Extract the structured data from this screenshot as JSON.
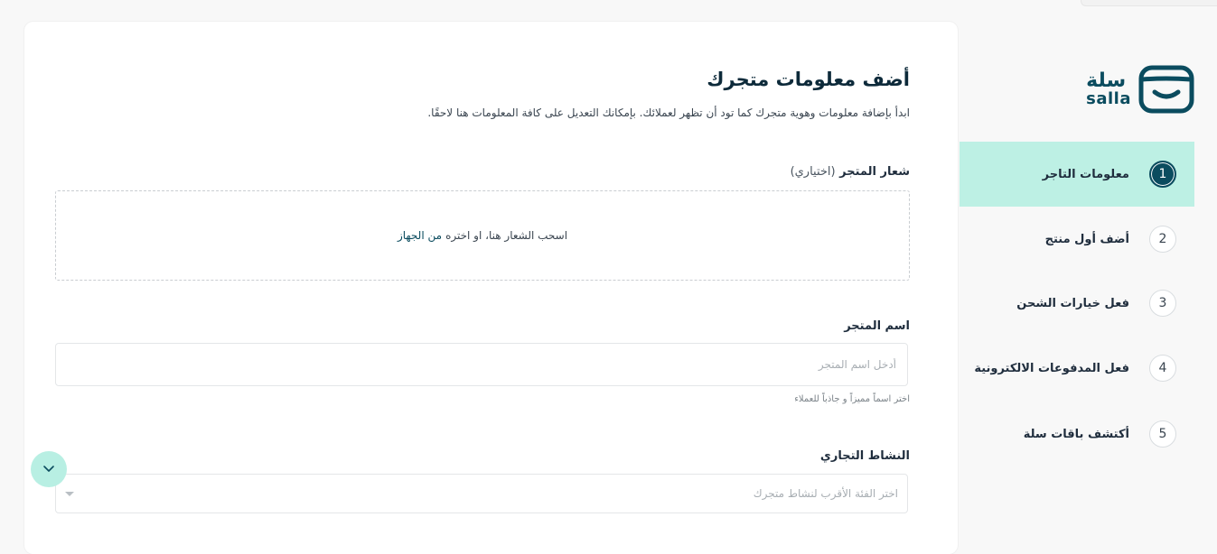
{
  "form": {
    "title": "أضف معلومات متجرك",
    "subtitle": "ابدأ بإضافة معلومات وهوية متجرك كما تود أن تظهر لعملائك. بإمكانك التعديل على كافة المعلومات هنا لاحقًا.",
    "logo_label": "شعار المتجر",
    "logo_optional": "(اختياري)",
    "dropzone_text": "اسحب الشعار هنا، او اختره",
    "dropzone_link": "من الجهاز",
    "store_name_label": "اسم المتجر",
    "store_name_placeholder": "أدخل اسم المتجر",
    "store_name_value": "",
    "store_name_hint": "اختر اسماً مميزاً و جاذباً للعملاء",
    "activity_label": "النشاط التجاري",
    "activity_placeholder": "اختر الفئة الأقرب لنشاط متجرك"
  },
  "brand": {
    "name_ar": "سلة",
    "name_en": "salla",
    "color": "#0b4c5f"
  },
  "steps": [
    {
      "number": "1",
      "label": "معلومات التاجر",
      "active": true
    },
    {
      "number": "2",
      "label": "أضف أول منتج",
      "active": false
    },
    {
      "number": "3",
      "label": "فعل خيارات الشحن",
      "active": false
    },
    {
      "number": "4",
      "label": "فعل المدفوعات الالكترونية",
      "active": false
    },
    {
      "number": "5",
      "label": "أكتشف باقات سلة",
      "active": false
    }
  ],
  "colors": {
    "accent": "#bdf0e4",
    "primary": "#0b4c5f"
  },
  "icons": {
    "fab": "chevron-down-icon",
    "select_caret": "caret-down-icon",
    "brand_logo": "salla-bag-icon"
  }
}
